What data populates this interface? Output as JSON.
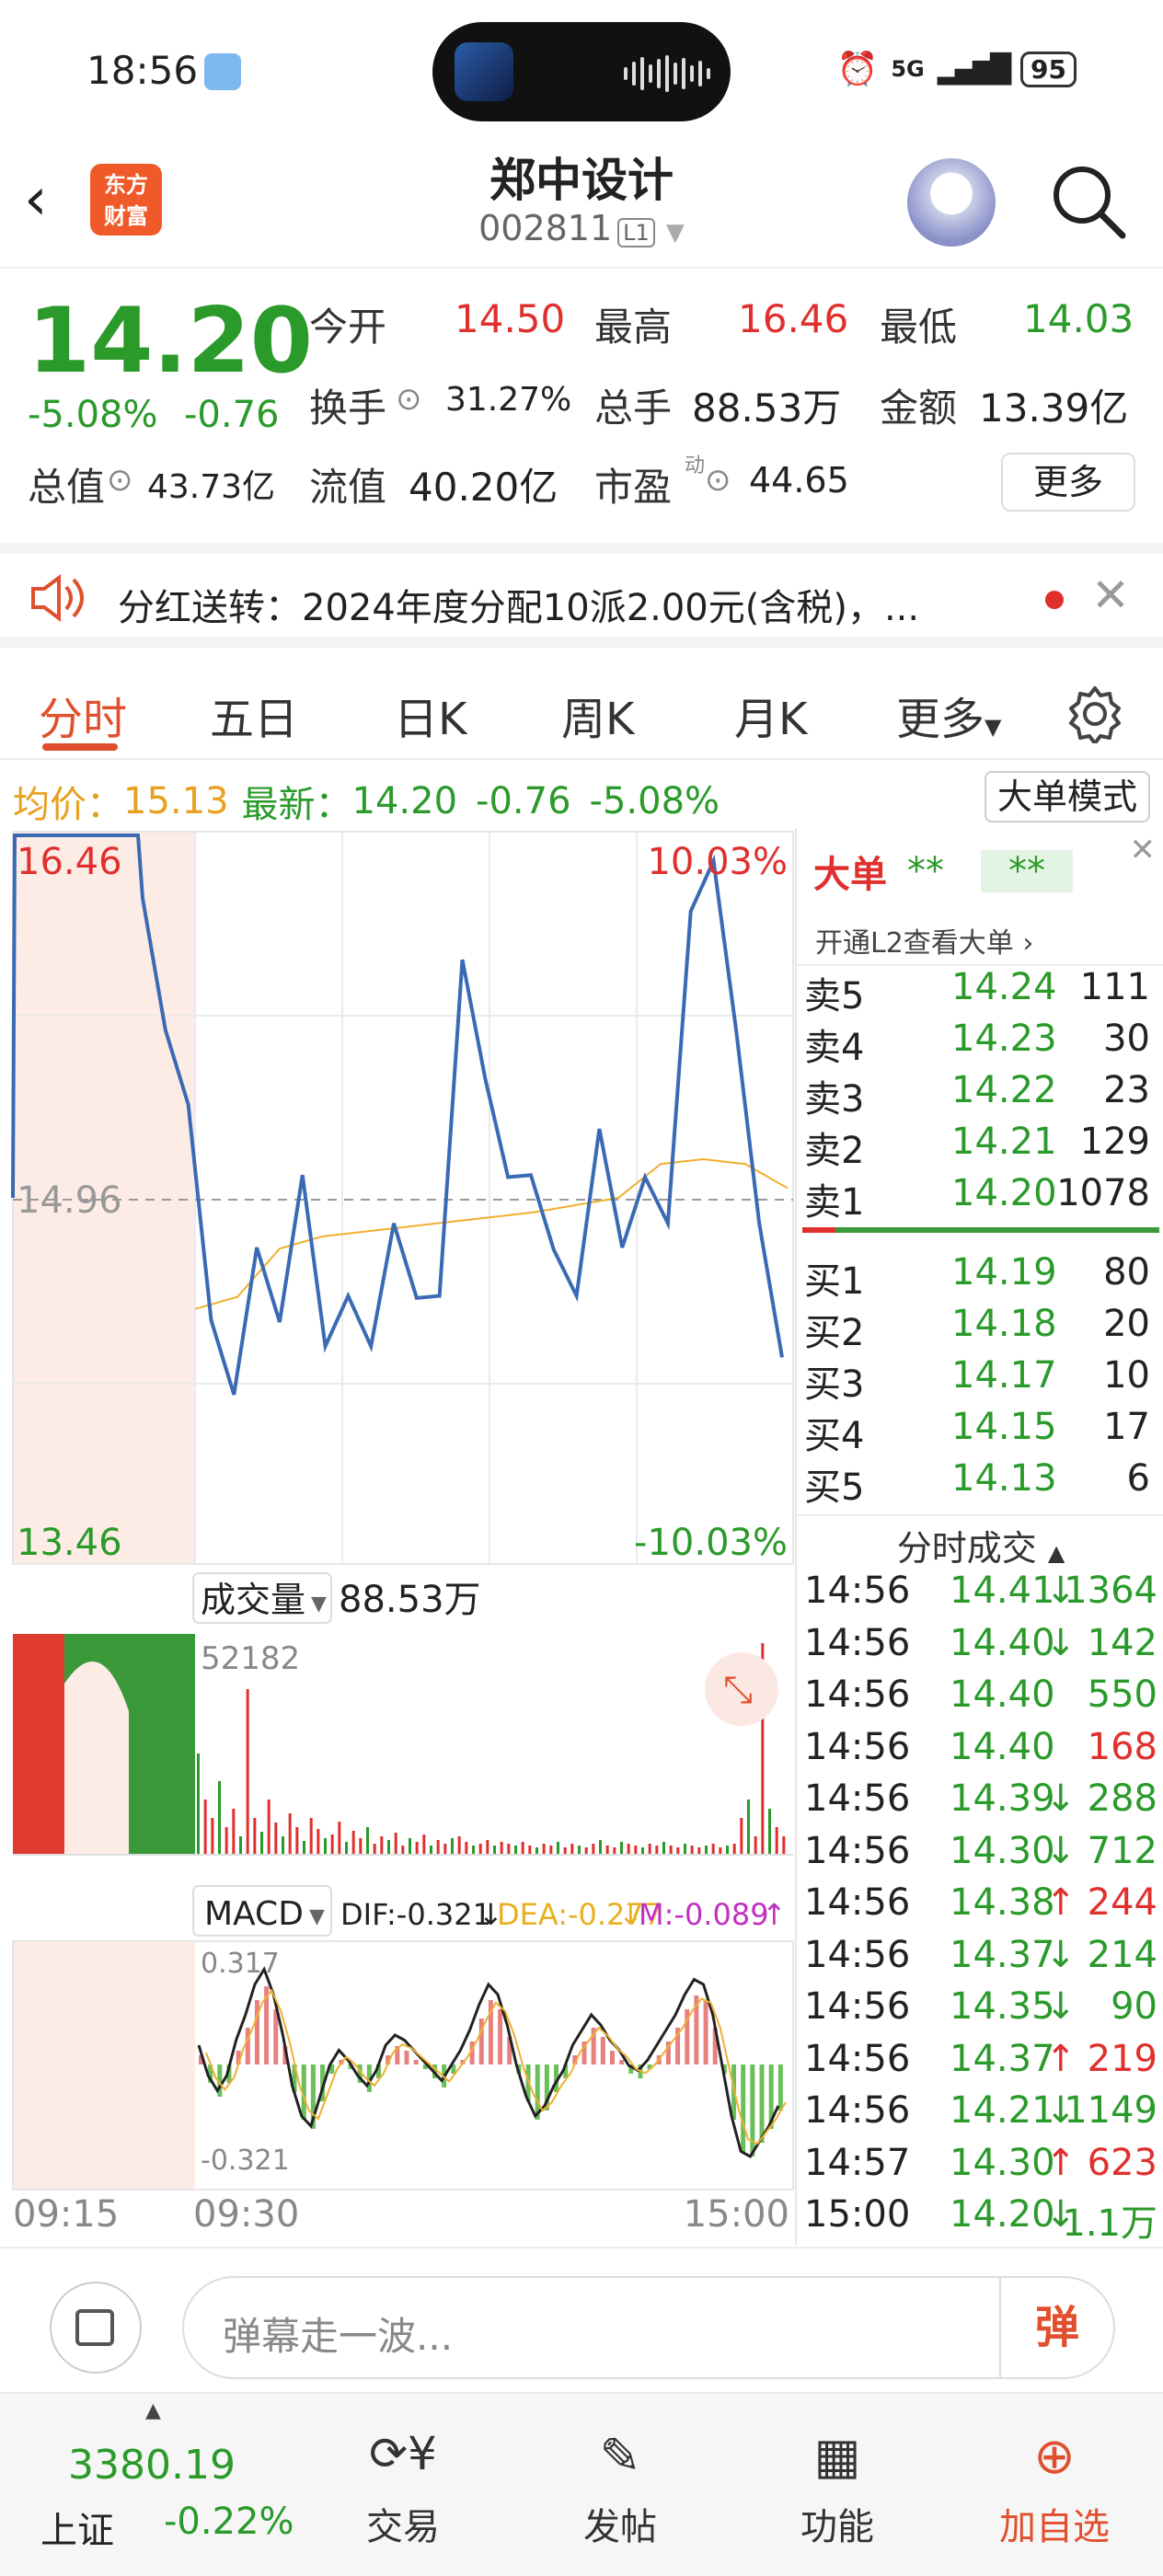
{
  "status_bar": {
    "time": "18:56",
    "network": "5G",
    "battery": "95"
  },
  "header": {
    "title": "郑中设计",
    "code": "002811",
    "level": "L1",
    "logo_text": [
      "东方",
      "财富"
    ]
  },
  "quote": {
    "price": "14.20",
    "change_pct": "-5.08%",
    "change": "-0.76",
    "open_label": "今开",
    "open": "14.50",
    "high_label": "最高",
    "high": "16.46",
    "low_label": "最低",
    "low": "14.03",
    "turnover_label": "换手",
    "turnover": "31.27%",
    "volume_label": "总手",
    "volume": "88.53万",
    "amount_label": "金额",
    "amount": "13.39亿",
    "mcap_label": "总值",
    "mcap": "43.73亿",
    "float_label": "流值",
    "float": "40.20亿",
    "pe_label": "市盈",
    "pe_sup": "动",
    "pe": "44.65",
    "more": "更多"
  },
  "notice": {
    "text": "分红送转：2024年度分配10派2.00元(含税)，..."
  },
  "tabs": [
    "分时",
    "五日",
    "日K",
    "周K",
    "月K",
    "更多"
  ],
  "infobar": {
    "avg_label": "均价：",
    "avg": "15.13",
    "latest_label": "最新：",
    "latest": "14.20",
    "change": "-0.76",
    "pct": "-5.08%",
    "mode_button": "大单模式"
  },
  "chart_data": [
    {
      "type": "line",
      "title": "分时",
      "x": [
        "09:15",
        "09:30",
        "15:00"
      ],
      "ylim": [
        13.46,
        16.46
      ],
      "ref_price": "14.96",
      "y_labels": {
        "top": "16.46",
        "mid": "14.96",
        "bottom": "13.46",
        "top_pct": "10.03%",
        "bottom_pct": "-10.03%"
      },
      "series": [
        {
          "values": [
            14.96,
            16.46,
            16.46,
            16.2,
            15.7,
            15.3,
            14.5,
            14.1,
            14.8,
            14.4,
            15.1,
            14.3,
            14.6,
            14.3,
            14.9,
            14.5,
            14.6,
            15.9,
            15.5,
            15.0,
            15.1,
            14.7,
            14.6,
            15.2,
            14.8,
            15.0,
            14.9,
            16.1,
            16.4,
            15.6,
            14.9,
            14.3
          ]
        },
        {
          "values": [
            14.5,
            14.55,
            14.75,
            14.8,
            14.82,
            14.84,
            14.86,
            14.88,
            14.9,
            14.93,
            14.96,
            15.1,
            15.12,
            15.1,
            15.0
          ]
        }
      ]
    },
    {
      "type": "bar",
      "title": "成交量",
      "label": "成交量",
      "total": "88.53万",
      "max_label": "52182"
    },
    {
      "type": "bar",
      "title": "MACD",
      "dif": "DIF:-0.321",
      "dea": "DEA:-0.277",
      "m": "M:-0.089",
      "max_label": "0.317",
      "min_label": "-0.321"
    }
  ],
  "order_book": {
    "header": "大单",
    "stars1": "**",
    "stars2": "**",
    "l2_link": "开通L2查看大单",
    "asks": [
      {
        "k": "卖5",
        "p": "14.24",
        "v": "111"
      },
      {
        "k": "卖4",
        "p": "14.23",
        "v": "30"
      },
      {
        "k": "卖3",
        "p": "14.22",
        "v": "23"
      },
      {
        "k": "卖2",
        "p": "14.21",
        "v": "129"
      },
      {
        "k": "卖1",
        "p": "14.20",
        "v": "1078"
      }
    ],
    "bids": [
      {
        "k": "买1",
        "p": "14.19",
        "v": "80"
      },
      {
        "k": "买2",
        "p": "14.18",
        "v": "20"
      },
      {
        "k": "买3",
        "p": "14.17",
        "v": "10"
      },
      {
        "k": "买4",
        "p": "14.15",
        "v": "17"
      },
      {
        "k": "买5",
        "p": "14.13",
        "v": "6"
      }
    ]
  },
  "trades": {
    "header": "分时成交",
    "rows": [
      {
        "t": "14:56",
        "p": "14.41",
        "d": "↓",
        "v": "1364",
        "c": "green"
      },
      {
        "t": "14:56",
        "p": "14.40",
        "d": "↓",
        "v": "142",
        "c": "green"
      },
      {
        "t": "14:56",
        "p": "14.40",
        "d": "",
        "v": "550",
        "c": "green"
      },
      {
        "t": "14:56",
        "p": "14.40",
        "d": "",
        "v": "168",
        "c": "red"
      },
      {
        "t": "14:56",
        "p": "14.39",
        "d": "↓",
        "v": "288",
        "c": "green"
      },
      {
        "t": "14:56",
        "p": "14.30",
        "d": "↓",
        "v": "712",
        "c": "green"
      },
      {
        "t": "14:56",
        "p": "14.38",
        "d": "↑",
        "v": "244",
        "c": "red"
      },
      {
        "t": "14:56",
        "p": "14.37",
        "d": "↓",
        "v": "214",
        "c": "green"
      },
      {
        "t": "14:56",
        "p": "14.35",
        "d": "↓",
        "v": "90",
        "c": "green"
      },
      {
        "t": "14:56",
        "p": "14.37",
        "d": "↑",
        "v": "219",
        "c": "red"
      },
      {
        "t": "14:56",
        "p": "14.21",
        "d": "↓",
        "v": "1149",
        "c": "green"
      },
      {
        "t": "14:57",
        "p": "14.30",
        "d": "↑",
        "v": "623",
        "c": "red"
      },
      {
        "t": "15:00",
        "p": "14.20",
        "d": "↓",
        "v": "1.1万",
        "c": "green"
      }
    ]
  },
  "danmu": {
    "placeholder": "弹幕走一波...",
    "send": "弹"
  },
  "bottom_nav": {
    "index_value": "3380.19",
    "index_name": "上证",
    "index_change": "-0.22%",
    "items": [
      "交易",
      "发帖",
      "功能",
      "加自选"
    ]
  },
  "colors": {
    "up": "#e0302e",
    "down": "#2a9a2a",
    "accent": "#e0502e",
    "line": "#3a6ab4",
    "avg": "#f0b030"
  }
}
